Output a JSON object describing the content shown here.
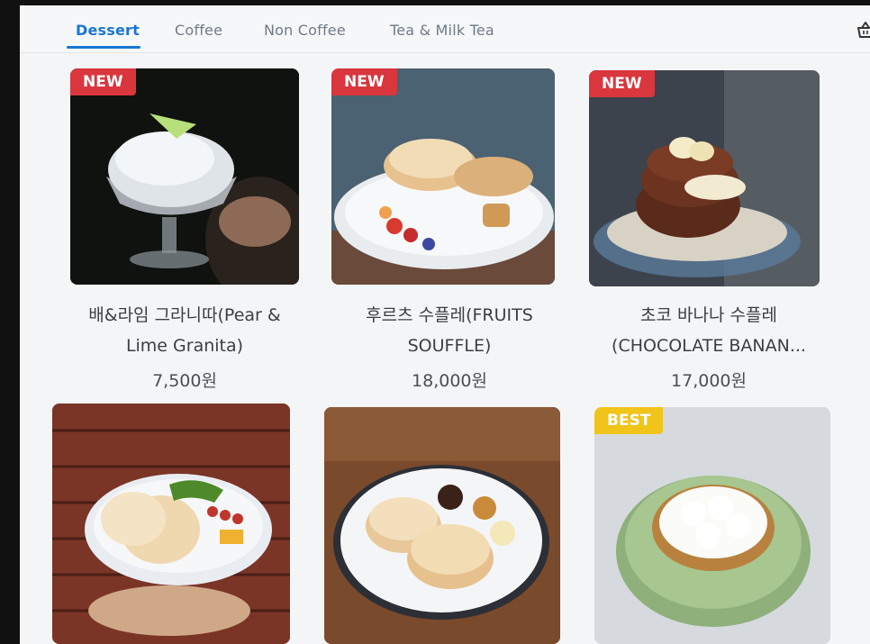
{
  "tabs": [
    {
      "label": "Dessert",
      "active": true
    },
    {
      "label": "Coffee",
      "active": false
    },
    {
      "label": "Non Coffee",
      "active": false
    },
    {
      "label": "Tea & Milk Tea",
      "active": false
    }
  ],
  "accent_color": "#1976d2",
  "cart_icon": "basket-icon",
  "products": [
    {
      "name_line1": "배&라임 그라니따(Pear &",
      "name_line2": "Lime Granita)",
      "price": "7,500원",
      "badge": "NEW",
      "image": "granita-photo"
    },
    {
      "name_line1": "후르츠 수플레(FRUITS",
      "name_line2": "SOUFFLE)",
      "price": "18,000원",
      "badge": "NEW",
      "image": "fruit-souffle-photo"
    },
    {
      "name_line1": "초코 바나나 수플레",
      "name_line2": "(CHOCOLATE BANAN...",
      "price": "17,000원",
      "badge": "NEW",
      "image": "choco-banana-souffle-photo"
    },
    {
      "badge": "",
      "image": "souffle-sausage-plate-photo"
    },
    {
      "badge": "",
      "image": "plain-souffle-photo"
    },
    {
      "badge": "BEST",
      "image": "lemon-tart-photo"
    }
  ]
}
